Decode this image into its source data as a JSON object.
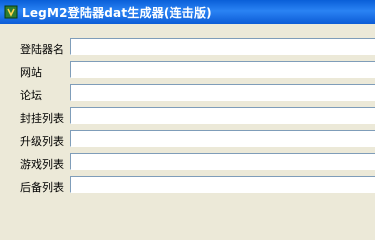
{
  "window": {
    "title": "LegM2登陆器dat生成器(连击版)",
    "icon": "app-icon"
  },
  "fields": [
    {
      "label": "登陆器名",
      "value": ""
    },
    {
      "label": "网站",
      "value": ""
    },
    {
      "label": "论坛",
      "value": ""
    },
    {
      "label": "封挂列表",
      "value": ""
    },
    {
      "label": "升级列表",
      "value": ""
    },
    {
      "label": "游戏列表",
      "value": ""
    },
    {
      "label": "后备列表",
      "value": ""
    }
  ],
  "colors": {
    "titlebar": "#0A5FD8",
    "window_bg": "#ECE9D8",
    "field_border": "#7F9DB9"
  }
}
